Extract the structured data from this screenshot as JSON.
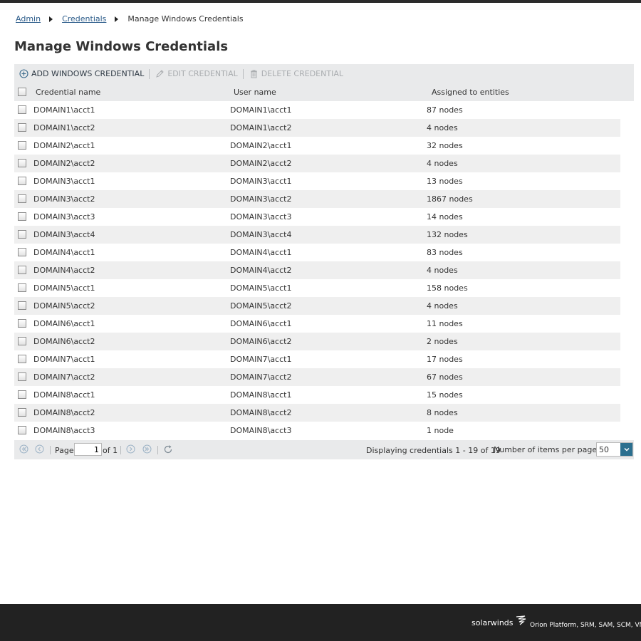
{
  "breadcrumb": {
    "admin": "Admin",
    "credentials": "Credentials",
    "current": "Manage Windows Credentials"
  },
  "page_title": "Manage Windows Credentials",
  "toolbar": {
    "add": "ADD WINDOWS CREDENTIAL",
    "edit": "EDIT CREDENTIAL",
    "delete": "DELETE CREDENTIAL"
  },
  "columns": {
    "name": "Credential name",
    "user": "User name",
    "assigned": "Assigned to entities"
  },
  "rows": [
    {
      "name": "DOMAIN1\\acct1",
      "user": "DOMAIN1\\acct1",
      "assigned": "87 nodes"
    },
    {
      "name": "DOMAIN1\\acct2",
      "user": "DOMAIN1\\acct2",
      "assigned": "4 nodes"
    },
    {
      "name": "DOMAIN2\\acct1",
      "user": "DOMAIN2\\acct1",
      "assigned": "32 nodes"
    },
    {
      "name": "DOMAIN2\\acct2",
      "user": "DOMAIN2\\acct2",
      "assigned": "4 nodes"
    },
    {
      "name": "DOMAIN3\\acct1",
      "user": "DOMAIN3\\acct1",
      "assigned": "13 nodes"
    },
    {
      "name": "DOMAIN3\\acct2",
      "user": "DOMAIN3\\acct2",
      "assigned": "1867 nodes"
    },
    {
      "name": "DOMAIN3\\acct3",
      "user": "DOMAIN3\\acct3",
      "assigned": "14 nodes"
    },
    {
      "name": "DOMAIN3\\acct4",
      "user": "DOMAIN3\\acct4",
      "assigned": "132 nodes"
    },
    {
      "name": "DOMAIN4\\acct1",
      "user": "DOMAIN4\\acct1",
      "assigned": "83 nodes"
    },
    {
      "name": "DOMAIN4\\acct2",
      "user": "DOMAIN4\\acct2",
      "assigned": "4 nodes"
    },
    {
      "name": "DOMAIN5\\acct1",
      "user": "DOMAIN5\\acct1",
      "assigned": "158 nodes"
    },
    {
      "name": "DOMAIN5\\acct2",
      "user": "DOMAIN5\\acct2",
      "assigned": "4 nodes"
    },
    {
      "name": "DOMAIN6\\acct1",
      "user": "DOMAIN6\\acct1",
      "assigned": "11 nodes"
    },
    {
      "name": "DOMAIN6\\acct2",
      "user": "DOMAIN6\\acct2",
      "assigned": "2 nodes"
    },
    {
      "name": "DOMAIN7\\acct1",
      "user": "DOMAIN7\\acct1",
      "assigned": "17 nodes"
    },
    {
      "name": "DOMAIN7\\acct2",
      "user": "DOMAIN7\\acct2",
      "assigned": "67 nodes"
    },
    {
      "name": "DOMAIN8\\acct1",
      "user": "DOMAIN8\\acct1",
      "assigned": "15 nodes"
    },
    {
      "name": "DOMAIN8\\acct2",
      "user": "DOMAIN8\\acct2",
      "assigned": "8 nodes"
    },
    {
      "name": "DOMAIN8\\acct3",
      "user": "DOMAIN8\\acct3",
      "assigned": "1 node"
    }
  ],
  "pager": {
    "page_label": "Page",
    "page_value": "1",
    "of_label": "of 1",
    "display": "Displaying credentials 1 - 19 of 19",
    "per_page_label": "Number of items per page:",
    "per_page_value": "50"
  },
  "footer": {
    "brand": "solarwinds",
    "products": "Orion Platform, SRM, SAM, SCM, VMAN"
  },
  "colors": {
    "accent": "#2b6f8f",
    "link": "#2c5c8a",
    "footer_bg": "#222222",
    "toolbar_bg": "#e9eaeb"
  },
  "icons": [
    "plus-circle-icon",
    "pencil-icon",
    "trash-icon",
    "first-page-icon",
    "prev-page-icon",
    "next-page-icon",
    "last-page-icon",
    "refresh-icon",
    "chevron-down-icon",
    "solarwinds-logo-icon"
  ]
}
